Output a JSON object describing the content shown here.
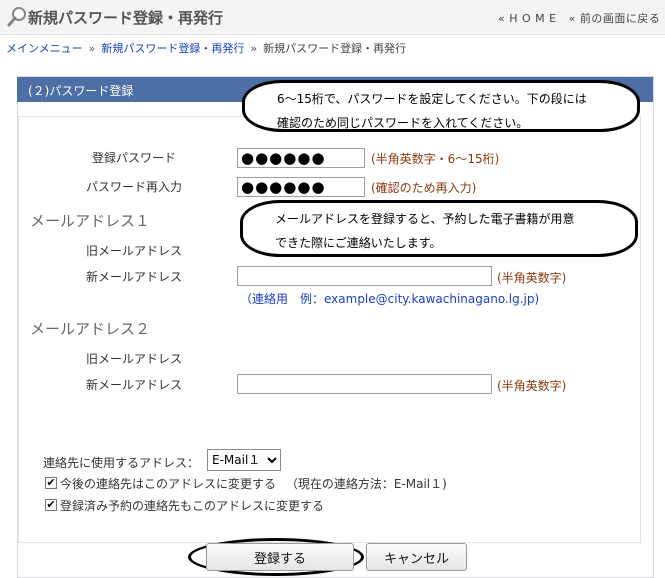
{
  "header": {
    "title": "新規パスワード登録・再発行",
    "home_link": "« H O M E",
    "back_link": "« 前の画面に戻る"
  },
  "breadcrumb": {
    "main_menu": "メインメニュー",
    "parent": "新規パスワード登録・再発行",
    "current": "新規パスワード登録・再発行",
    "separator": "»"
  },
  "panel": {
    "title": "(２)パスワード登録"
  },
  "callouts": {
    "password_line1": "6～15桁で、パスワードを設定してください。下の段には",
    "password_line2": "確認のため同じパスワードを入れてください。",
    "email_line1": "メールアドレスを登録すると、予約した電子書籍が用意",
    "email_line2": "できた際にご連絡いたします。"
  },
  "password": {
    "label": "登録パスワード",
    "value": "●●●●●●",
    "note": "(半角英数字・6～15桁)"
  },
  "password_confirm": {
    "label": "パスワード再入力",
    "value": "●●●●●●",
    "note": "(確認のため再入力)"
  },
  "email1": {
    "section_title": "メールアドレス１",
    "old_label": "旧メールアドレス",
    "new_label": "新メールアドレス",
    "new_value": "",
    "note": "(半角英数字)",
    "example": "（連絡用　例：example@city.kawachinagano.lg.jp)"
  },
  "email2": {
    "section_title": "メールアドレス２",
    "old_label": "旧メールアドレス",
    "new_label": "新メールアドレス",
    "new_value": "",
    "note": "(半角英数字)"
  },
  "contact": {
    "label": "連絡先に使用するアドレス：",
    "selected": "E-Mail１",
    "change_future": "今後の連絡先はこのアドレスに変更する",
    "current_method": "（現在の連絡方法：E-Mail１)",
    "change_reserved": "登録済み予約の連絡先もこのアドレスに変更する",
    "change_future_checked": true,
    "change_reserved_checked": true
  },
  "buttons": {
    "submit": "登録する",
    "cancel": "キャンセル"
  },
  "colors": {
    "panel_header": "#4e6fa5",
    "note_text": "#8a3a12",
    "link": "#1a3fb0"
  },
  "icons": {
    "header": "search-icon",
    "select": "chevron-down-icon",
    "checkbox": "check-icon"
  }
}
